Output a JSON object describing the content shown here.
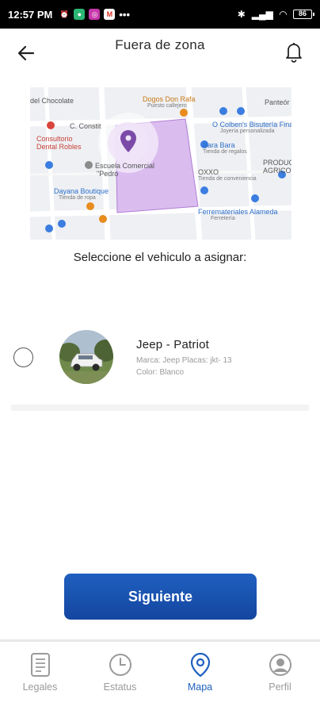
{
  "status_bar": {
    "time": "12:57 PM",
    "battery": "86"
  },
  "header": {
    "title": "Fuera de zona"
  },
  "map": {
    "labels": {
      "chocolate": "del Chocolate",
      "dogos": "Dogos Don Rafa",
      "dogos_sub": "Puesto callejero",
      "pantenor": "Panteór",
      "consultorio": "Consultorio",
      "consultorio2": "Dental Robles",
      "constitucion": "C. Constit",
      "colben": "O Colben's Bisutería Fina",
      "colben_sub": "Joyería personalizada",
      "bara": "Bara Bara",
      "bara_sub": "Tienda de regalos",
      "escuela": "Escuela Comercial",
      "escuela2": "\"Pedro",
      "oxxo": "OXXO",
      "oxxo_sub": "Tienda de conveniencia",
      "produc": "PRODUCT",
      "agricola": "AGRICOLA",
      "dayana": "Dayana Boutique",
      "dayana_sub": "Tienda de ropa",
      "ferre": "Ferremateriales Alameda",
      "ferre_sub": "Ferretería"
    }
  },
  "prompt": "Seleccione el vehiculo a asignar:",
  "vehicle": {
    "name": "Jeep - Patriot",
    "meta": "Marca: Jeep    Placas: jkt-    13",
    "color": "Color: Blanco"
  },
  "next_button": "Siguiente",
  "nav": {
    "items": [
      {
        "label": "Legales"
      },
      {
        "label": "Estatus"
      },
      {
        "label": "Mapa"
      },
      {
        "label": "Perfil"
      }
    ]
  },
  "colors": {
    "accent": "#1f5fbf",
    "zone_fill": "#d7b6ee",
    "zone_pin": "#7b4aa8"
  }
}
